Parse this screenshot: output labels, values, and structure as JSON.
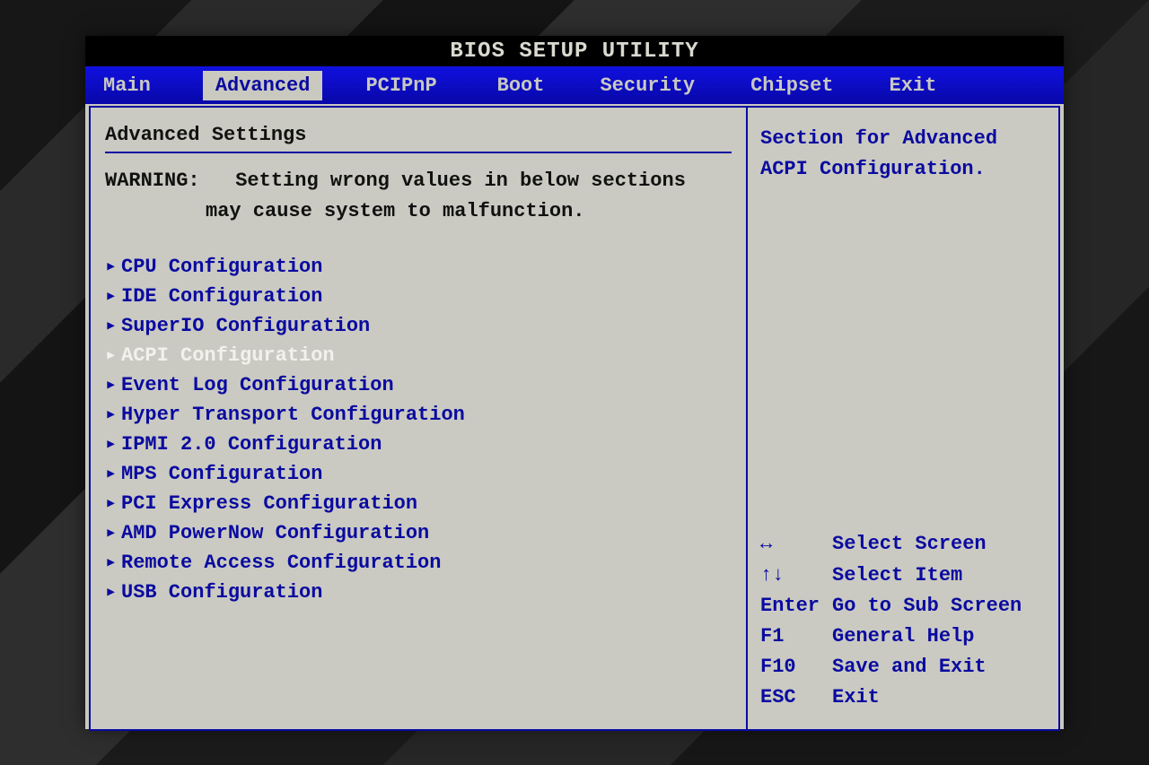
{
  "title": "BIOS SETUP UTILITY",
  "tabs": [
    {
      "id": "main",
      "label": "Main",
      "active": false
    },
    {
      "id": "advanced",
      "label": "Advanced",
      "active": true
    },
    {
      "id": "pcipnp",
      "label": "PCIPnP",
      "active": false
    },
    {
      "id": "boot",
      "label": "Boot",
      "active": false
    },
    {
      "id": "security",
      "label": "Security",
      "active": false
    },
    {
      "id": "chipset",
      "label": "Chipset",
      "active": false
    },
    {
      "id": "exit",
      "label": "Exit",
      "active": false
    }
  ],
  "section_title": "Advanced Settings",
  "warning": {
    "label": "WARNING:",
    "line1": "Setting wrong values in below sections",
    "line2": "may cause system to malfunction."
  },
  "menu_items": [
    {
      "id": "cpu",
      "label": "CPU Configuration",
      "selected": false
    },
    {
      "id": "ide",
      "label": "IDE Configuration",
      "selected": false
    },
    {
      "id": "sio",
      "label": "SuperIO Configuration",
      "selected": false
    },
    {
      "id": "acpi",
      "label": "ACPI Configuration",
      "selected": true
    },
    {
      "id": "evlog",
      "label": "Event Log Configuration",
      "selected": false
    },
    {
      "id": "ht",
      "label": "Hyper Transport Configuration",
      "selected": false
    },
    {
      "id": "ipmi",
      "label": "IPMI 2.0 Configuration",
      "selected": false
    },
    {
      "id": "mps",
      "label": "MPS Configuration",
      "selected": false
    },
    {
      "id": "pcie",
      "label": "PCI Express Configuration",
      "selected": false
    },
    {
      "id": "pn",
      "label": "AMD PowerNow Configuration",
      "selected": false
    },
    {
      "id": "remote",
      "label": "Remote Access Configuration",
      "selected": false
    },
    {
      "id": "usb",
      "label": "USB Configuration",
      "selected": false
    }
  ],
  "help": {
    "line1": "Section for Advanced",
    "line2": "ACPI Configuration."
  },
  "key_hints": [
    {
      "key": "↔",
      "desc": "Select Screen"
    },
    {
      "key": "↑↓",
      "desc": "Select Item"
    },
    {
      "key": "Enter",
      "desc": "Go to Sub Screen"
    },
    {
      "key": "F1",
      "desc": "General Help"
    },
    {
      "key": "F10",
      "desc": "Save and Exit"
    },
    {
      "key": "ESC",
      "desc": "Exit"
    }
  ],
  "icons": {
    "submenu_arrow": "▸"
  }
}
